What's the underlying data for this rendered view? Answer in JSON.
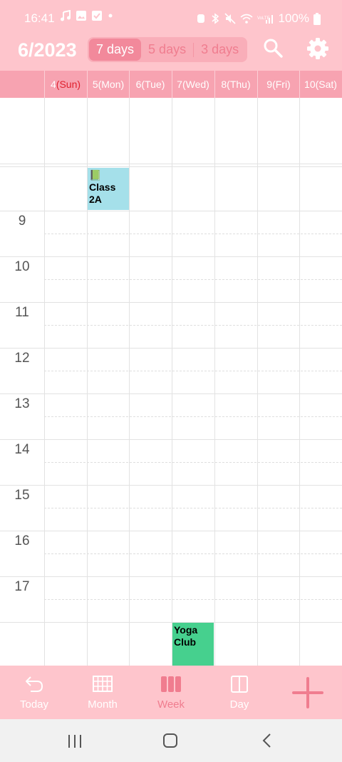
{
  "status": {
    "time": "16:41",
    "battery": "100%"
  },
  "header": {
    "title": "6/2023",
    "segments": [
      "7 days",
      "5 days",
      "3 days"
    ]
  },
  "days": [
    {
      "num": "4",
      "name": "(Sun)"
    },
    {
      "num": "5",
      "name": "(Mon)"
    },
    {
      "num": "6",
      "name": "(Tue)"
    },
    {
      "num": "7",
      "name": "(Wed)"
    },
    {
      "num": "8",
      "name": "(Thu)"
    },
    {
      "num": "9",
      "name": "(Fri)"
    },
    {
      "num": "10",
      "name": "(Sat)"
    }
  ],
  "hours": [
    "9",
    "10",
    "11",
    "12",
    "13",
    "14",
    "15",
    "16",
    "17"
  ],
  "events": [
    {
      "title": "📗Class 2A",
      "day": "5(Mon)",
      "color": "#a5e0ea"
    },
    {
      "title": "Yoga Club",
      "day": "7(Wed)",
      "color": "#46d08e"
    }
  ],
  "bottom_nav": [
    "Today",
    "Month",
    "Week",
    "Day"
  ],
  "colors": {
    "bar_pink": "#fec5cc",
    "header_pink": "#f7a3b1",
    "accent": "#f07d8f"
  }
}
